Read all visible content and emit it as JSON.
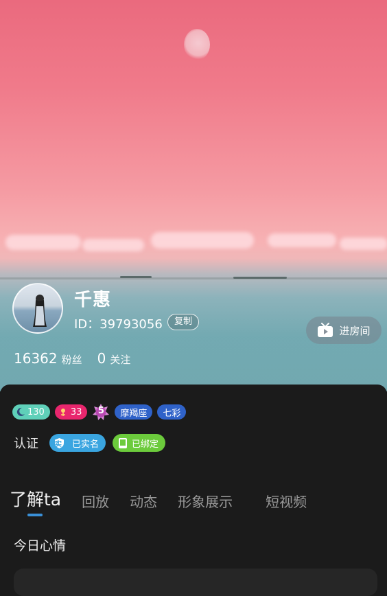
{
  "profile": {
    "name": "千惠",
    "id_text": "ID：39793056",
    "copy_label": "复制",
    "enter_room_label": "进房间",
    "fans_count": "16362",
    "fans_label": "粉丝",
    "follow_count": "0",
    "follow_label": "关注"
  },
  "badges": {
    "moon_value": "130",
    "heart_value": "33",
    "level_value": "5",
    "zodiac": "摩羯座",
    "color_tag": "七彩"
  },
  "certification": {
    "label": "认证",
    "real_name_icon": "实",
    "real_name": "已实名",
    "bound": "已绑定"
  },
  "tabs": [
    {
      "label": "了解ta"
    },
    {
      "label": "回放"
    },
    {
      "label": "动态"
    },
    {
      "label": "形象展示"
    },
    {
      "label": "短视频"
    }
  ],
  "mood": {
    "title": "今日心情"
  },
  "colors": {
    "tab_indicator": "#3a90d8",
    "real_name_badge": "#3aa5e0",
    "bound_badge": "#6ccb3c",
    "heart_badge": "#e8266d",
    "moon_badge": "#5fd0b9"
  }
}
